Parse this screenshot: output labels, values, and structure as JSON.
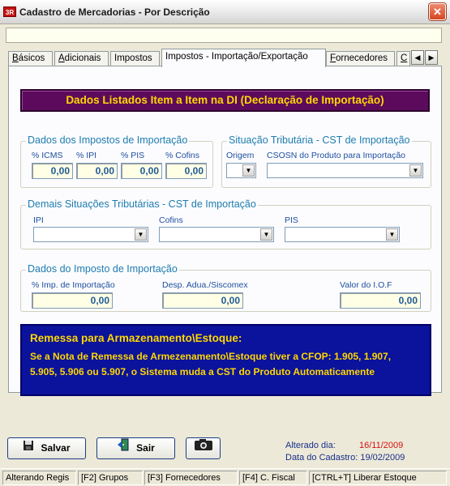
{
  "window": {
    "title": "Cadastro de Mercadorias - Por Descrição",
    "icon_text": "3R",
    "close": "✕"
  },
  "tabs": [
    {
      "label": "Básicos",
      "ul": "B",
      "rest": "ásicos"
    },
    {
      "label": "Adicionais",
      "ul": "A",
      "rest": "dicionais"
    },
    {
      "label": "Impostos",
      "ul": "",
      "rest": "Impostos"
    },
    {
      "label": "Impostos - Importação/Exportação",
      "ul": "",
      "rest": "Impostos - Importação/Exportação"
    },
    {
      "label": "Fornecedores",
      "ul": "F",
      "rest": "ornecedores"
    },
    {
      "label": "C",
      "ul": "C",
      "rest": ""
    }
  ],
  "banner": "Dados Listados Item a Item na DI (Declaração de Importação)",
  "dados_impostos": {
    "title": "Dados dos Impostos de Importação",
    "fields": [
      {
        "label": "% ICMS",
        "value": "0,00"
      },
      {
        "label": "% IPI",
        "value": "0,00"
      },
      {
        "label": "% PIS",
        "value": "0,00"
      },
      {
        "label": "% Cofins",
        "value": "0,00"
      }
    ]
  },
  "situacao": {
    "title": "Situação Tributária - CST de Importação",
    "origem_label": "Origem",
    "csosn_label": "CSOSN do Produto para Importação"
  },
  "demais": {
    "title": "Demais Situações Tributárias - CST de Importação",
    "ipi_label": "IPI",
    "cofins_label": "Cofins",
    "pis_label": "PIS"
  },
  "imposto_importacao": {
    "title": "Dados do Imposto de Importação",
    "pct_label": "% Imp. de Importação",
    "pct_value": "0,00",
    "desp_label": "Desp. Adua./Siscomex",
    "desp_value": "0,00",
    "iof_label": "Valor do I.O.F",
    "iof_value": "0,00"
  },
  "remessa": {
    "title": "Remessa para Armazenamento\\Estoque:",
    "line1": "Se a Nota de Remessa de Armezenamento\\Estoque tiver a CFOP: 1.905, 1.907,",
    "line2": "5.905, 5.906 ou 5.907, o Sistema muda a CST do Produto Automaticamente"
  },
  "buttons": {
    "salvar": "Salvar",
    "sair": "Sair"
  },
  "footer": {
    "alterado_label": "Alterado dia:",
    "alterado_date": "16/11/2009",
    "cadastro": "Data do Cadastro: 19/02/2009"
  },
  "status": [
    "Alterando Regis",
    "[F2] Grupos",
    "[F3] Fornecedores",
    "[F4] C. Fiscal",
    "[CTRL+T] Liberar Estoque"
  ],
  "colors": {
    "banner_bg": "#5c0b5c",
    "banner_text": "#ffd700",
    "info_bg": "#0b129b",
    "group_label": "#1e7cb0",
    "date_red": "#d61111"
  }
}
